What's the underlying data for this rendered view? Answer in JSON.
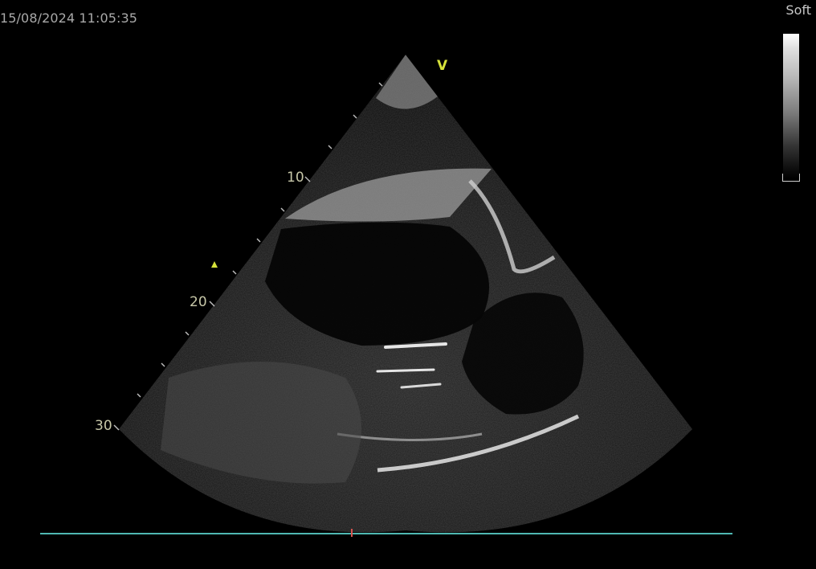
{
  "header": {
    "timestamp": "15/08/2024 11:05:35",
    "preset": "Soft"
  },
  "image": {
    "orientation_marker": "V",
    "depth_labels": [
      "10",
      "20",
      "30"
    ]
  },
  "colors": {
    "orientation_marker": "#d6e23a",
    "focus_marker": "#d6e23a",
    "ecg_trace": "#4fb8b2",
    "ecg_cursor": "#d9534f",
    "depth_label": "#c7c7a8"
  }
}
